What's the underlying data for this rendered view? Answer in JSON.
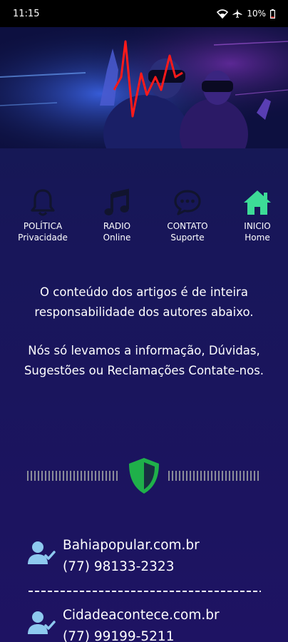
{
  "status_bar": {
    "time": "11:15",
    "battery": "10%"
  },
  "nav": [
    {
      "label": "POLÍTICA",
      "sub": "Privacidade",
      "icon": "bell-icon"
    },
    {
      "label": "RADIO",
      "sub": "Online",
      "icon": "music-note-icon"
    },
    {
      "label": "CONTATO",
      "sub": "Suporte",
      "icon": "chat-bubble-icon"
    },
    {
      "label": "INICIO",
      "sub": "Home",
      "icon": "home-icon"
    }
  ],
  "info": {
    "line1": "O conteúdo dos artigos é de inteira responsabilidade dos autores abaixo.",
    "line2": "Nós só levamos a informação, Dúvidas, Sugestões ou Reclamações Contate-nos."
  },
  "contacts": [
    {
      "site": "Bahiapopular.com.br",
      "phone": "(77) 98133-2323"
    },
    {
      "site": "Cidadeacontece.com.br",
      "phone": "(77) 99199-5211"
    }
  ],
  "colors": {
    "background": "#18165a",
    "home_icon": "#3ddc97",
    "shield": "#1fb04a",
    "contact_icon": "#8ec9ef"
  }
}
